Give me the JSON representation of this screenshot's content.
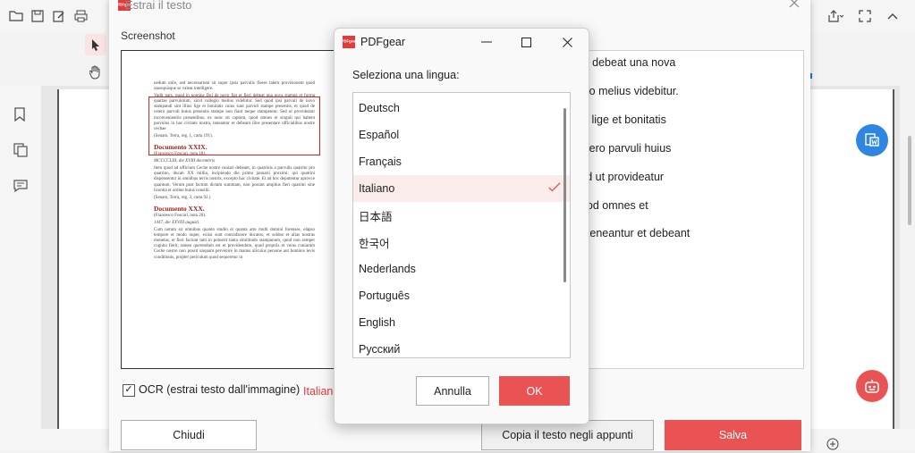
{
  "main_dialog": {
    "title": "Estrai il testo",
    "logo": "PDFgear",
    "screenshot_label": "Screenshot",
    "ocr_checked": true,
    "ocr_label": "OCR (estrai testo dall'immagine)",
    "ocr_language": "Italiano",
    "close_button": "Chiudi",
    "copy_button": "Copia il testo negli appunti",
    "save_button": "Salva",
    "extracted_lines": [
      "ieri debeat una nova",
      "egio melius videbitur.",
      "ius lige et bonitatis",
      "cetero parvuli huius",
      "sed ut provideatur",
      "quod omnes et",
      "a, teneantur et debeant"
    ]
  },
  "document_preview": {
    "intro": "nedum utile, sed necessarium sit super ipsis parvulis fieere talem provisionem quod unusquisque se valeat intelligere.",
    "highlight": "Vadit pars, quod in nomine Dei de novo fiat et fieri debeat una nova stampa et forma quartae parvulorum, sicut collegio melius videbitur. Sed quod ipsi parvuli de novo stampandi sint illius lige et bonitatis cuius sunt parvuli stampe presentis, et quod de cetero parvuli huius presentis stampe non fiant neque stampentur. Sed ut provideatur inconvenientiis presentibus, ex nunc sit captum, quod omnes et singuli qui habent parvulos in hac civitate nostra, teneantur et debeant illos presentare officialibus nostre cechae",
    "source1": "(Senato, Terra, reg. 1, carta 191).",
    "heading1": "Documento XXIX.",
    "note1": "(Francesco Foscari, nota 18).",
    "date1": "MCCCCLIII, die XVIII decembris",
    "body1": "Item quod ad officium Ceche nostre cuniari debeant, in quatrinis a parvulis quatrini pro quatrino, ducati XX millia, incipiendo die primo januarii proximi: qui quatrini dispensentur in omnibus terris nostris, excepto hac civitate. Et ad hoc deputentur aprovce quantum. Verum post factum dictam summam, non possint amplius fieri quatrini sine licentia et ordine huius consilii.",
    "source2": "(Senato, Terra, reg. 3, carta 92.)",
    "heading2": "Documento XXX.",
    "note2": "(Francesco Foscari, nota 26).",
    "date2": "1447, die XXVIII augusti.",
    "body2": "Cum notum sit omnibus quanto studio et quanta arte multi domini forenses, elapso tempore et modo nuper, exiisi sunt contrafacere ducatos, et soldos et alias nostras monetas, et fieri faciunt tam in potuerit tanta similitudo stampanum, quod non semper cognita fierit, tamen querendum est et providendum, quod propriis et veras cuniarum Ceche nostre non possit unquam pervenire in manus alicuius persone aut hominis levis conditionis, propter periculum quod sequeretur in"
  },
  "language_dialog": {
    "logo": "PDFgear",
    "title": "PDFgear",
    "prompt": "Seleziona una lingua:",
    "languages": [
      "Deutsch",
      "Español",
      "Français",
      "Italiano",
      "日本語",
      "한국어",
      "Nederlands",
      "Português",
      "English",
      "Русский"
    ],
    "selected": "Italiano",
    "cancel_button": "Annulla",
    "ok_button": "OK"
  },
  "icons": {
    "open": "folder-icon",
    "save": "save-icon",
    "edit": "edit-icon",
    "print": "print-icon",
    "select": "cursor-icon",
    "hand": "hand-icon",
    "bookmark": "bookmark-icon",
    "pages": "pages-icon",
    "comment": "comment-icon",
    "share": "share-icon",
    "fullscreen": "fullscreen-icon",
    "collapse": "chevron-up-icon",
    "convert": "convert-word-icon",
    "assistant": "robot-icon"
  },
  "colors": {
    "accent": "#ea5353",
    "ocr_language": "#e03c3c",
    "fab_blue": "#2f86e0"
  }
}
